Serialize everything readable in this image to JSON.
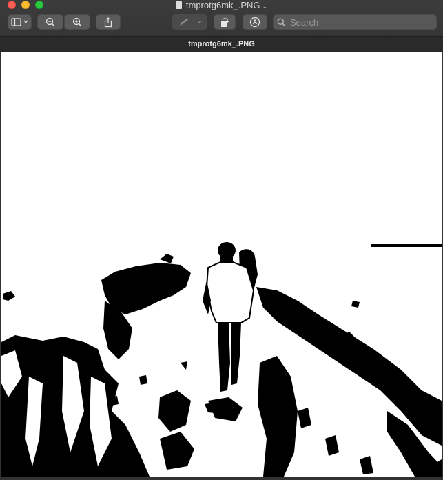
{
  "window": {
    "title": "tmprotg6mk_.PNG",
    "tab_label": "tmprotg6mk_.PNG"
  },
  "toolbar": {
    "sidebar_icon": "sidebar-icon",
    "zoom_out_icon": "zoom-out-icon",
    "zoom_in_icon": "zoom-in-icon",
    "share_icon": "share-icon",
    "markup_icon": "pen-icon",
    "rotate_icon": "rotate-icon",
    "annotate_icon": "markup-circle-icon"
  },
  "search": {
    "placeholder": "Search"
  },
  "colors": {
    "toolbar_bg": "#3a3a3a",
    "tab_bg": "#2a2a2a",
    "canvas_bg": "#ffffff",
    "close": "#fe5f57",
    "minimize": "#febc2e",
    "maximize": "#28c840"
  }
}
